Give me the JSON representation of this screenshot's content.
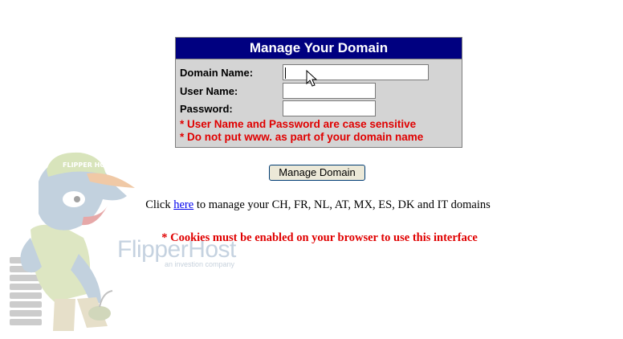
{
  "form": {
    "title": "Manage Your Domain",
    "domain_label": "Domain Name:",
    "domain_value": "",
    "username_label": "User Name:",
    "username_value": "",
    "password_label": "Password:",
    "password_value": "",
    "note_case": "* User Name and Password are case sensitive",
    "note_www": "* Do not put www. as part of your domain name",
    "submit_label": "Manage Domain"
  },
  "info": {
    "prefix": "Click ",
    "link_text": "here",
    "suffix": " to manage your CH, FR, NL, AT, MX, ES, DK and IT domains"
  },
  "cookie_notice": "* Cookies must be enabled on your browser to use this interface",
  "brand": {
    "name_part1": "Flipper",
    "name_part2": "Host",
    "tagline": "an investion company",
    "cap_text": "FLIPPER HOST"
  },
  "colors": {
    "header_bg": "#000080",
    "panel_bg": "#d4d4d4",
    "note_red": "#e00000",
    "link_blue": "#0000ee"
  },
  "icons": {
    "mascot": "dolphin-mascot-illustration",
    "cursor": "mouse-pointer-icon"
  }
}
